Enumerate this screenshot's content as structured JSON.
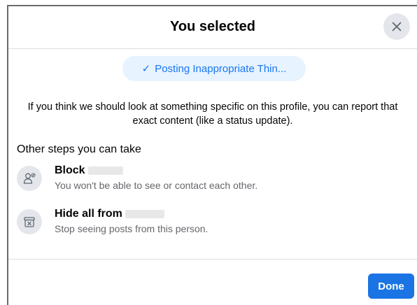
{
  "header": {
    "title": "You selected",
    "close_icon": "close-icon"
  },
  "selected_reason": {
    "check_glyph": "✓",
    "label": "Posting Inappropriate Thin..."
  },
  "description": "If you think we should look at something specific on this profile, you can report that exact content (like a status update).",
  "other_steps": {
    "title": "Other steps you can take",
    "items": [
      {
        "icon": "block-person-icon",
        "title": "Block",
        "subtitle": "You won't be able to see or contact each other."
      },
      {
        "icon": "hide-box-icon",
        "title": "Hide all from",
        "subtitle": "Stop seeing posts from this person."
      }
    ]
  },
  "footer": {
    "done_label": "Done"
  },
  "colors": {
    "accent": "#1877f2",
    "button": "#1b74e4",
    "chip_bg": "#e7f3ff",
    "icon_bg": "#e4e6eb",
    "secondary_text": "#65676b"
  }
}
